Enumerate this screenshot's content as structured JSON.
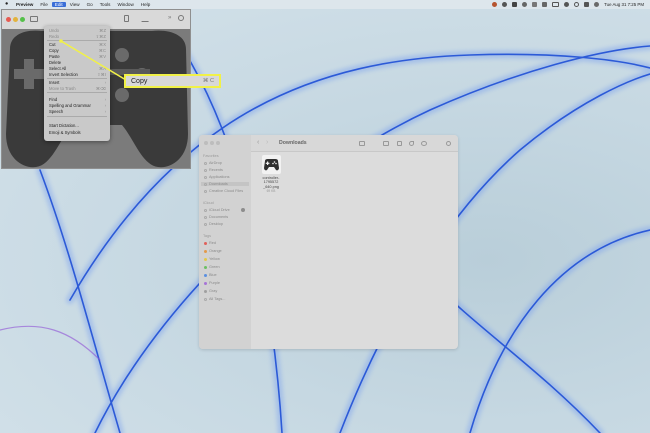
{
  "menubar": {
    "app_name": "Preview",
    "items": [
      "File",
      "Edit",
      "View",
      "Go",
      "Tools",
      "Window",
      "Help"
    ],
    "clock": "Tue Aug 31  7:25 PM"
  },
  "edit_menu": {
    "items": [
      {
        "label": "Undo",
        "shortcut": "⌘Z",
        "dim": true
      },
      {
        "label": "Redo",
        "shortcut": "⇧⌘Z",
        "dim": true
      },
      {
        "label": "Cut",
        "shortcut": "⌘X",
        "dim": false
      },
      {
        "label": "Copy",
        "shortcut": "⌘C",
        "dim": false
      },
      {
        "label": "Paste",
        "shortcut": "⌘V",
        "dim": false
      },
      {
        "label": "Delete",
        "shortcut": "",
        "dim": false
      },
      {
        "label": "Select All",
        "shortcut": "⌘A",
        "dim": false
      },
      {
        "label": "Invert Selection",
        "shortcut": "⇧⌘I",
        "dim": false
      },
      {
        "label": "Insert",
        "shortcut": "›",
        "dim": false
      },
      {
        "label": "Move to Trash",
        "shortcut": "⌘⌫",
        "dim": true
      },
      {
        "label": "Find",
        "shortcut": "›",
        "dim": false
      },
      {
        "label": "Spelling and Grammar",
        "shortcut": "›",
        "dim": false
      },
      {
        "label": "Speech",
        "shortcut": "›",
        "dim": false
      },
      {
        "label": "Start Dictation...",
        "shortcut": "",
        "dim": false
      },
      {
        "label": "Emoji & Symbols",
        "shortcut": "",
        "dim": false
      }
    ]
  },
  "callout": {
    "label": "Copy",
    "shortcut": "⌘ C"
  },
  "finder": {
    "title": "Downloads",
    "sidebar": {
      "favorites_header": "Favorites",
      "favorites": [
        "AirDrop",
        "Recents",
        "Applications",
        "Downloads",
        "Creative Cloud Files"
      ],
      "icloud_header": "iCloud",
      "icloud": [
        "iCloud Drive",
        "Documents",
        "Desktop"
      ],
      "tags_header": "Tags",
      "tags": [
        {
          "label": "Red",
          "color": "#e0605a"
        },
        {
          "label": "Orange",
          "color": "#e39a4b"
        },
        {
          "label": "Yellow",
          "color": "#e2c84a"
        },
        {
          "label": "Green",
          "color": "#6cbf63"
        },
        {
          "label": "Blue",
          "color": "#5a8fe0"
        },
        {
          "label": "Purple",
          "color": "#a774d6"
        },
        {
          "label": "Gray",
          "color": "#a0a0a0"
        },
        {
          "label": "All Tags...",
          "color": ""
        }
      ]
    },
    "file": {
      "name_line1": "controller-1795572",
      "name_line2": "_640.png",
      "size": "69 KB"
    }
  },
  "colors": {
    "highlight": "#f1f147",
    "menu_active": "#3a6fd8",
    "wave": "#1f4fd6"
  }
}
